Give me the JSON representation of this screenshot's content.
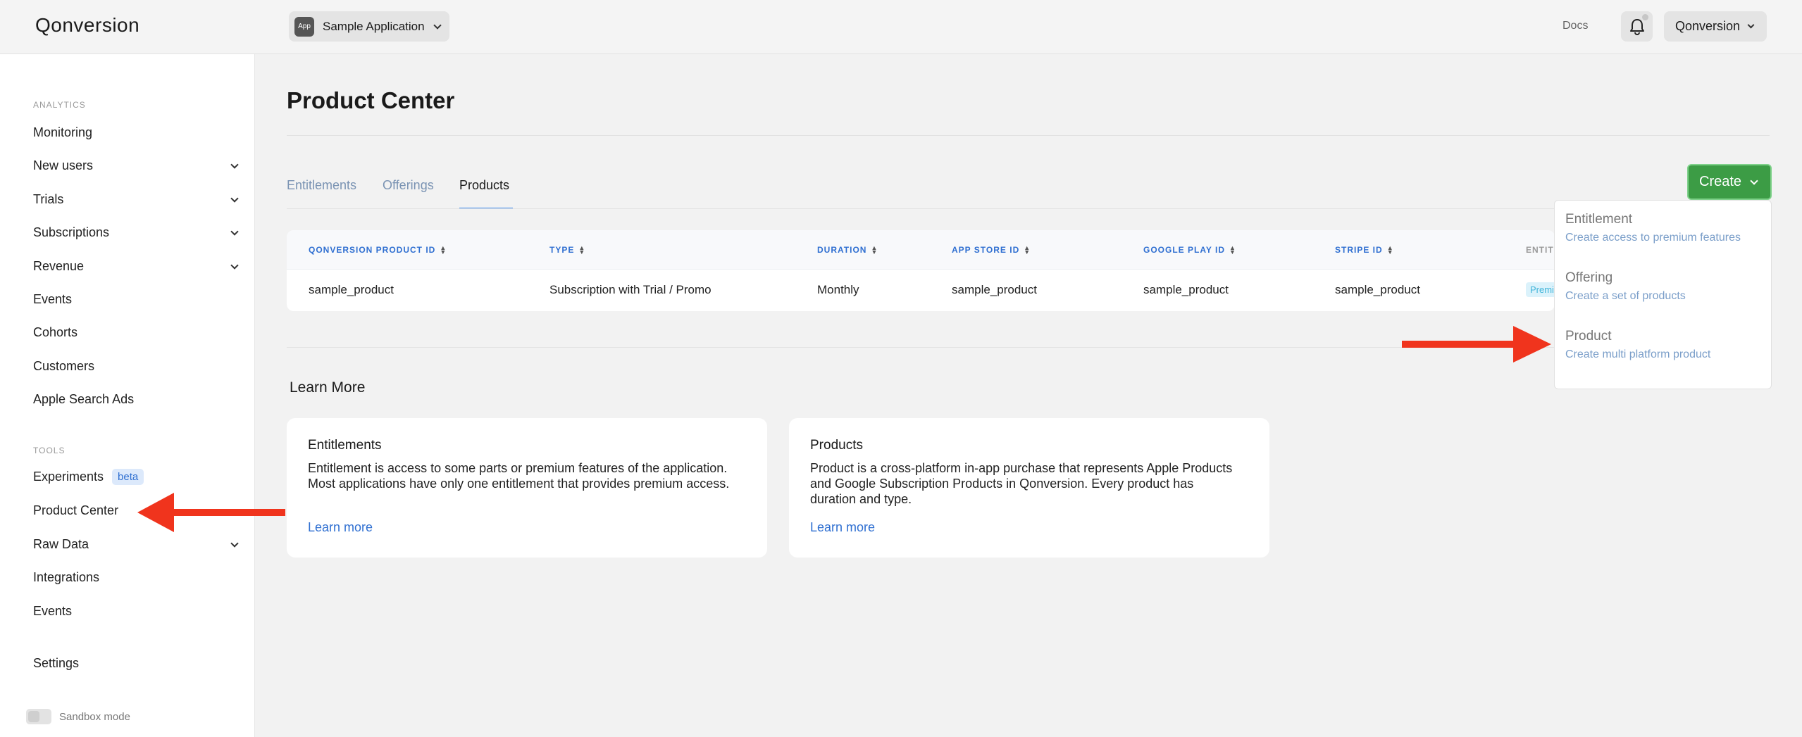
{
  "header": {
    "logo": "Qonversion",
    "app_badge": "App",
    "app_name": "Sample Application",
    "docs": "Docs",
    "account": "Qonversion"
  },
  "sidebar": {
    "analytics_label": "ANALYTICS",
    "analytics_items": [
      {
        "label": "Monitoring",
        "expandable": false
      },
      {
        "label": "New users",
        "expandable": true
      },
      {
        "label": "Trials",
        "expandable": true
      },
      {
        "label": "Subscriptions",
        "expandable": true
      },
      {
        "label": "Revenue",
        "expandable": true
      },
      {
        "label": "Events",
        "expandable": false
      },
      {
        "label": "Cohorts",
        "expandable": false
      },
      {
        "label": "Customers",
        "expandable": false
      },
      {
        "label": "Apple Search Ads",
        "expandable": false
      }
    ],
    "tools_label": "TOOLS",
    "tools_items": [
      {
        "label": "Experiments",
        "badge": "beta"
      },
      {
        "label": "Product Center"
      },
      {
        "label": "Raw Data",
        "expandable": true
      },
      {
        "label": "Integrations"
      },
      {
        "label": "Events"
      }
    ],
    "settings": "Settings",
    "sandbox": "Sandbox mode"
  },
  "main": {
    "title": "Product Center",
    "tabs": [
      "Entitlements",
      "Offerings",
      "Products"
    ],
    "active_tab": "Products",
    "create_button": "Create",
    "table": {
      "headers": [
        "QONVERSION PRODUCT ID",
        "TYPE",
        "DURATION",
        "APP STORE ID",
        "GOOGLE PLAY ID",
        "STRIPE ID",
        "ENTITLEMENTS"
      ],
      "header_visible": [
        "QONVERSION PRODUCT ID",
        "TYPE",
        "DURATION",
        "APP STORE ID",
        "GOOGLE PLAY ID",
        "STRIPE ID",
        "ENTIT"
      ],
      "rows": [
        [
          "sample_product",
          "Subscription with Trial / Promo",
          "Monthly",
          "sample_product",
          "sample_product",
          "sample_product",
          "Premi"
        ]
      ]
    },
    "dropdown": [
      {
        "title": "Entitlement",
        "desc": "Create access to premium features"
      },
      {
        "title": "Offering",
        "desc": "Create a set of products"
      },
      {
        "title": "Product",
        "desc": "Create multi platform product"
      }
    ],
    "learn_more_title": "Learn More",
    "cards": [
      {
        "title": "Entitlements",
        "text": "Entitlement is access to some parts or premium features of the application. Most applications have only one entitlement that provides premium access.",
        "link": "Learn more"
      },
      {
        "title": "Products",
        "text": "Product is a cross-platform in-app purchase that represents Apple Products and Google Subscription Products in Qonversion. Every product has duration and type.",
        "link": "Learn more"
      }
    ]
  },
  "colors": {
    "accent_blue": "#2f6fd1",
    "create_green": "#3c9c45",
    "annotation_arrow": "#f0341d"
  }
}
